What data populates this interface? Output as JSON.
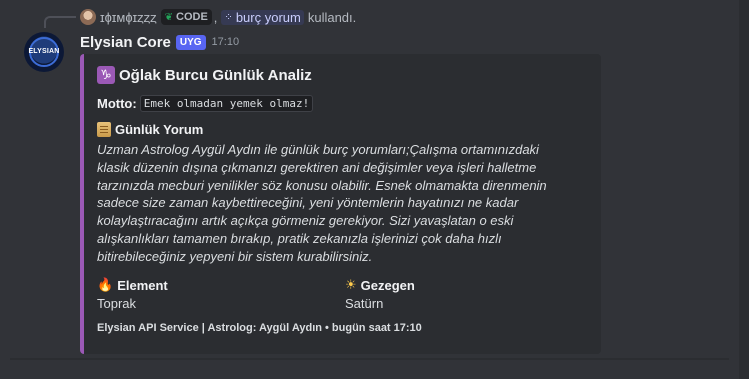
{
  "reply": {
    "username": "ɪɸɪᴍɸɪȥȥȥ",
    "tag_label": "CODE",
    "separator": ",",
    "command": "burç yorum",
    "suffix": "kullandı."
  },
  "message": {
    "bot_name": "Elysian Core",
    "badge": "UYG",
    "time": "17:10",
    "avatar_text": "ELYSIAN"
  },
  "embed": {
    "accent_color": "#9b59b6",
    "title_icon": "♑",
    "title": "Oğlak Burcu Günlük Analiz",
    "motto_label": "Motto:",
    "motto_value": "Emek olmadan yemek olmaz!",
    "section_title": "Günlük Yorum",
    "reading_lines": [
      "Uzman Astrolog Aygül Aydın ile günlük burç yorumları;Çalışma ortamınızdaki",
      "klasik düzenin dışına çıkmanızı gerektiren ani değişimler veya işleri halletme",
      "tarzınızda mecburi yenilikler söz konusu olabilir. Esnek olmamakta direnmenin",
      "sadece size zaman kaybettireceğini, yeni yöntemlerin hayatınızı ne kadar",
      "kolaylaştıracağını artık açıkça görmeniz gerekiyor. Sizi yavaşlatan o eski",
      "alışkanlıkları tamamen bırakıp, pratik zekanızla işlerinizi çok daha hızlı",
      "bitirebileceğiniz yepyeni bir sistem kurabilirsiniz."
    ],
    "fields": [
      {
        "icon": "🔥",
        "name": "Element",
        "value": "Toprak"
      },
      {
        "icon": "☀",
        "name": "Gezegen",
        "value": "Satürn"
      }
    ],
    "footer": "Elysian API Service | Astrolog: Aygül Aydın • bugün saat 17:10"
  }
}
